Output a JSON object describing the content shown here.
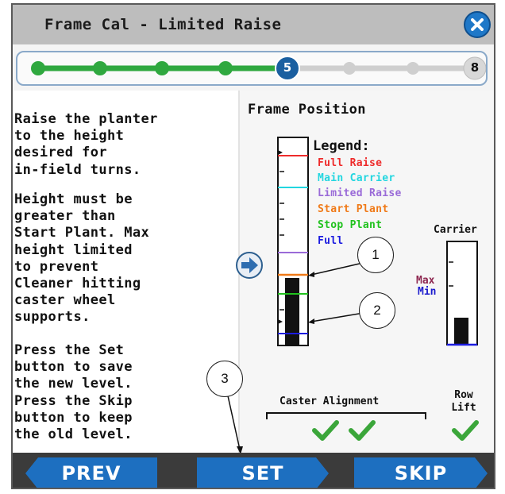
{
  "window": {
    "title": "Frame Cal - Limited Raise",
    "close_icon": "close-x-icon"
  },
  "progress": {
    "current_step": "5",
    "last_step": "8",
    "total_steps": 8,
    "completed_color": "#2fa83f",
    "current_color": "#1a5fa0",
    "pending_color": "#cfcfcf"
  },
  "instructions": {
    "paragraph1": "Raise the planter\nto the height\ndesired for\nin-field turns.",
    "paragraph2": "Height must be\ngreater than\nStart Plant. Max\nheight limited\nto prevent\nCleaner hitting\ncaster wheel\nsupports.",
    "paragraph3": "Press the Set\nbutton to save\nthe new level.\nPress the Skip\nbutton to keep\nthe old level."
  },
  "frame_position": {
    "title": "Frame Position",
    "legend_title": "Legend:",
    "legend": [
      {
        "label": "Full Raise",
        "color": "#ee2b2b"
      },
      {
        "label": "Main Carrier",
        "color": "#22d6e0"
      },
      {
        "label": "Limited Raise",
        "color": "#9a6bd8"
      },
      {
        "label": "Start Plant",
        "color": "#f07a18"
      },
      {
        "label": "Stop Plant",
        "color": "#21c21e"
      },
      {
        "label": "Full",
        "color": "#1c1ce0"
      }
    ],
    "arrow_icon": "arrow-right-icon"
  },
  "carrier": {
    "title": "Carrier",
    "max_label": "Max",
    "min_label": "Min"
  },
  "status": {
    "caster_alignment_label": "Caster Alignment",
    "caster_checks": 2,
    "row_lift_label": "Row\nLift",
    "row_lift_checks": 1,
    "check_color": "#3ba63a"
  },
  "callouts": [
    "1",
    "2",
    "3"
  ],
  "buttons": {
    "prev": "PREV",
    "set": "SET",
    "skip": "SKIP",
    "color": "#1d6fc0"
  }
}
